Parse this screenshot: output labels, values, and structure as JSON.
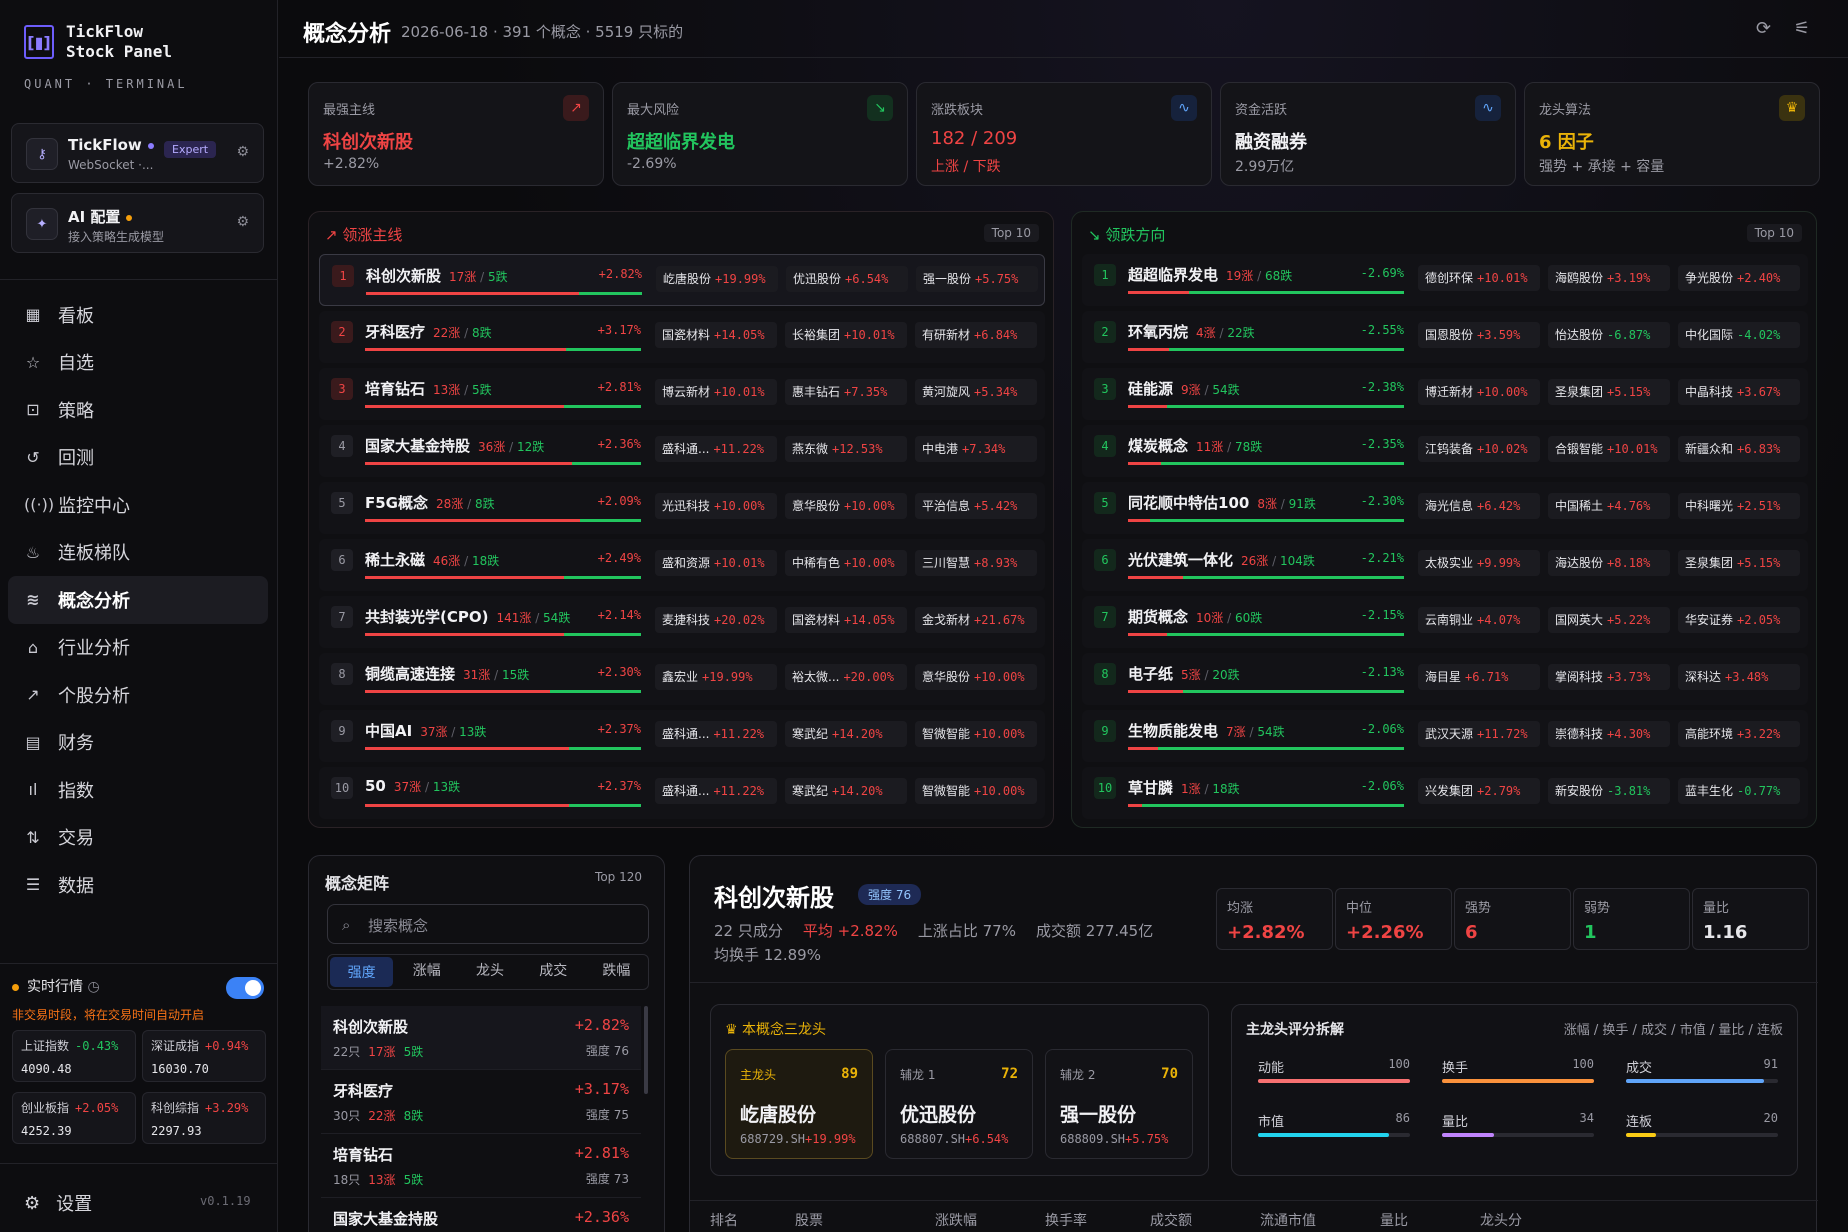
{
  "brand": {
    "title1": "TickFlow",
    "title2": "Stock Panel",
    "sub": "QUANT · TERMINAL",
    "mark": "[▮]"
  },
  "cards": {
    "tickflow": {
      "title": "TickFlow",
      "sub": "WebSocket ·...",
      "badge": "Expert"
    },
    "ai": {
      "title": "AI 配置",
      "sub": "接入策略生成模型"
    }
  },
  "nav": [
    "看板",
    "自选",
    "策略",
    "回测",
    "监控中心",
    "连板梯队",
    "概念分析",
    "行业分析",
    "个股分析",
    "财务",
    "指数",
    "交易",
    "数据"
  ],
  "nav_icons": [
    "grid-icon",
    "star-icon",
    "scan-icon",
    "history-icon",
    "radio-icon",
    "flame-icon",
    "layers-icon",
    "bank-icon",
    "trend-icon",
    "file-icon",
    "bar-chart-icon",
    "exchange-icon",
    "database-icon"
  ],
  "nav_glyphs": [
    "▦",
    "☆",
    "⊡",
    "↺",
    "((·))",
    "♨",
    "≋",
    "⌂",
    "↗",
    "▤",
    "ıl",
    "⇅",
    "☰"
  ],
  "realtime": {
    "label": "实时行情",
    "hint": "非交易时段，将在交易时间自动开启"
  },
  "indices": [
    {
      "name": "上证指数",
      "pct": "-0.43%",
      "val": "4090.48",
      "dir": "dn"
    },
    {
      "name": "深证成指",
      "pct": "+0.94%",
      "val": "16030.70",
      "dir": "up"
    },
    {
      "name": "创业板指",
      "pct": "+2.05%",
      "val": "4252.39",
      "dir": "up"
    },
    {
      "name": "科创综指",
      "pct": "+3.29%",
      "val": "2297.93",
      "dir": "up"
    }
  ],
  "settings": "设置",
  "version": "v0.1.19",
  "header": {
    "title": "概念分析",
    "meta": "2026-06-18 · 391 个概念 · 5519 只标的"
  },
  "kpis": [
    {
      "label": "最强主线",
      "value": "科创次新股",
      "sub": "+2.82%",
      "vcls": "up",
      "scls": "up",
      "icon": "↗",
      "icls": "#3a1a1c",
      "icol": "#ef4444"
    },
    {
      "label": "最大风险",
      "value": "超超临界发电",
      "sub": "-2.69%",
      "vcls": "dn",
      "scls": "dn",
      "icon": "↘",
      "icls": "#13301f",
      "icol": "#22c55e"
    },
    {
      "label": "涨跌板块",
      "value": "182 / 209",
      "sub": "上涨 / 下跌",
      "vcls": "up",
      "scls": "",
      "icon": "∿",
      "icls": "#16223c",
      "icol": "#60a5fa"
    },
    {
      "label": "资金活跃",
      "value": "融资融券",
      "sub": "2.99万亿",
      "vcls": "",
      "scls": "",
      "icon": "∿",
      "icls": "#16223c",
      "icol": "#60a5fa"
    },
    {
      "label": "龙头算法",
      "value": "6 因子",
      "sub": "强势 + 承接 + 容量",
      "vcls": "gold",
      "scls": "",
      "icon": "♛",
      "icls": "#3a3210",
      "icol": "#eab308"
    }
  ],
  "lead": {
    "title": "领涨主线",
    "top": "Top 10",
    "rows": [
      {
        "name": "科创次新股",
        "up": "17涨",
        "dn": "5跌",
        "pct": "+2.82%",
        "ratio": 77,
        "chips": [
          [
            "屹唐股份",
            "+19.99%"
          ],
          [
            "优迅股份",
            "+6.54%"
          ],
          [
            "强一股份",
            "+5.75%"
          ]
        ]
      },
      {
        "name": "牙科医疗",
        "up": "22涨",
        "dn": "8跌",
        "pct": "+3.17%",
        "ratio": 73,
        "chips": [
          [
            "国瓷材料",
            "+14.05%"
          ],
          [
            "长裕集团",
            "+10.01%"
          ],
          [
            "有研新材",
            "+6.84%"
          ]
        ]
      },
      {
        "name": "培育钻石",
        "up": "13涨",
        "dn": "5跌",
        "pct": "+2.81%",
        "ratio": 72,
        "chips": [
          [
            "博云新材",
            "+10.01%"
          ],
          [
            "惠丰钻石",
            "+7.35%"
          ],
          [
            "黄河旋风",
            "+5.34%"
          ]
        ]
      },
      {
        "name": "国家大基金持股",
        "up": "36涨",
        "dn": "12跌",
        "pct": "+2.36%",
        "ratio": 75,
        "chips": [
          [
            "盛科通...",
            "+11.22%"
          ],
          [
            "燕东微",
            "+12.53%"
          ],
          [
            "中电港",
            "+7.34%"
          ]
        ]
      },
      {
        "name": "F5G概念",
        "up": "28涨",
        "dn": "8跌",
        "pct": "+2.09%",
        "ratio": 78,
        "chips": [
          [
            "光迅科技",
            "+10.00%"
          ],
          [
            "意华股份",
            "+10.00%"
          ],
          [
            "平治信息",
            "+5.42%"
          ]
        ]
      },
      {
        "name": "稀土永磁",
        "up": "46涨",
        "dn": "18跌",
        "pct": "+2.49%",
        "ratio": 72,
        "chips": [
          [
            "盛和资源",
            "+10.01%"
          ],
          [
            "中稀有色",
            "+10.00%"
          ],
          [
            "三川智慧",
            "+8.93%"
          ]
        ]
      },
      {
        "name": "共封装光学(CPO)",
        "up": "141涨",
        "dn": "54跌",
        "pct": "+2.14%",
        "ratio": 72,
        "chips": [
          [
            "麦捷科技",
            "+20.02%"
          ],
          [
            "国瓷材料",
            "+14.05%"
          ],
          [
            "金戈新材",
            "+21.67%"
          ]
        ]
      },
      {
        "name": "铜缆高速连接",
        "up": "31涨",
        "dn": "15跌",
        "pct": "+2.30%",
        "ratio": 67,
        "chips": [
          [
            "鑫宏业",
            "+19.99%"
          ],
          [
            "裕太微...",
            "+20.00%"
          ],
          [
            "意华股份",
            "+10.00%"
          ]
        ]
      },
      {
        "name": "中国AI",
        "up": "37涨",
        "dn": "13跌",
        "pct": "+2.37%",
        "ratio": 74,
        "chips": [
          [
            "盛科通...",
            "+11.22%"
          ],
          [
            "寒武纪",
            "+14.20%"
          ],
          [
            "智微智能",
            "+10.00%"
          ]
        ]
      },
      {
        "name": "50",
        "up": "37涨",
        "dn": "13跌",
        "pct": "+2.37%",
        "ratio": 74,
        "chips": [
          [
            "盛科通...",
            "+11.22%"
          ],
          [
            "寒武纪",
            "+14.20%"
          ],
          [
            "智微智能",
            "+10.00%"
          ]
        ]
      }
    ]
  },
  "lag": {
    "title": "领跌方向",
    "top": "Top 10",
    "rows": [
      {
        "name": "超超临界发电",
        "up": "19涨",
        "dn": "68跌",
        "pct": "-2.69%",
        "ratio": 22,
        "chips": [
          [
            "德创环保",
            "+10.01%",
            "up"
          ],
          [
            "海鸥股份",
            "+3.19%",
            "up"
          ],
          [
            "争光股份",
            "+2.40%",
            "up"
          ]
        ]
      },
      {
        "name": "环氧丙烷",
        "up": "4涨",
        "dn": "22跌",
        "pct": "-2.55%",
        "ratio": 15,
        "chips": [
          [
            "国恩股份",
            "+3.59%",
            "up"
          ],
          [
            "怡达股份",
            "-6.87%",
            "dn"
          ],
          [
            "中化国际",
            "-4.02%",
            "dn"
          ]
        ]
      },
      {
        "name": "硅能源",
        "up": "9涨",
        "dn": "54跌",
        "pct": "-2.38%",
        "ratio": 14,
        "chips": [
          [
            "博迁新材",
            "+10.00%",
            "up"
          ],
          [
            "圣泉集团",
            "+5.15%",
            "up"
          ],
          [
            "中晶科技",
            "+3.67%",
            "up"
          ]
        ]
      },
      {
        "name": "煤炭概念",
        "up": "11涨",
        "dn": "78跌",
        "pct": "-2.35%",
        "ratio": 12,
        "chips": [
          [
            "江钨装备",
            "+10.02%",
            "up"
          ],
          [
            "合锻智能",
            "+10.01%",
            "up"
          ],
          [
            "新疆众和",
            "+6.83%",
            "up"
          ]
        ]
      },
      {
        "name": "同花顺中特估100",
        "up": "8涨",
        "dn": "91跌",
        "pct": "-2.30%",
        "ratio": 8,
        "chips": [
          [
            "海光信息",
            "+6.42%",
            "up"
          ],
          [
            "中国稀土",
            "+4.76%",
            "up"
          ],
          [
            "中科曙光",
            "+2.51%",
            "up"
          ]
        ]
      },
      {
        "name": "光伏建筑一体化",
        "up": "26涨",
        "dn": "104跌",
        "pct": "-2.21%",
        "ratio": 20,
        "chips": [
          [
            "太极实业",
            "+9.99%",
            "up"
          ],
          [
            "海达股份",
            "+8.18%",
            "up"
          ],
          [
            "圣泉集团",
            "+5.15%",
            "up"
          ]
        ]
      },
      {
        "name": "期货概念",
        "up": "10涨",
        "dn": "60跌",
        "pct": "-2.15%",
        "ratio": 14,
        "chips": [
          [
            "云南铜业",
            "+4.07%",
            "up"
          ],
          [
            "国网英大",
            "+5.22%",
            "up"
          ],
          [
            "华安证券",
            "+2.05%",
            "up"
          ]
        ]
      },
      {
        "name": "电子纸",
        "up": "5涨",
        "dn": "20跌",
        "pct": "-2.13%",
        "ratio": 20,
        "chips": [
          [
            "海目星",
            "+6.71%",
            "up"
          ],
          [
            "掌阅科技",
            "+3.73%",
            "up"
          ],
          [
            "深科达",
            "+3.48%",
            "up"
          ]
        ]
      },
      {
        "name": "生物质能发电",
        "up": "7涨",
        "dn": "54跌",
        "pct": "-2.06%",
        "ratio": 11,
        "chips": [
          [
            "武汉天源",
            "+11.72%",
            "up"
          ],
          [
            "崇德科技",
            "+4.30%",
            "up"
          ],
          [
            "高能环境",
            "+3.22%",
            "up"
          ]
        ]
      },
      {
        "name": "草甘膦",
        "up": "1涨",
        "dn": "18跌",
        "pct": "-2.06%",
        "ratio": 5,
        "chips": [
          [
            "兴发集团",
            "+2.79%",
            "up"
          ],
          [
            "新安股份",
            "-3.81%",
            "dn"
          ],
          [
            "蓝丰生化",
            "-0.77%",
            "dn"
          ]
        ]
      }
    ]
  },
  "matrix": {
    "title": "概念矩阵",
    "top": "Top 120",
    "search_ph": "搜索概念",
    "tabs": [
      "强度",
      "涨幅",
      "龙头",
      "成交",
      "跌幅"
    ],
    "rows": [
      {
        "name": "科创次新股",
        "pct": "+2.82%",
        "n": "22只",
        "up": "17涨",
        "dn": "5跌",
        "str": "强度 76"
      },
      {
        "name": "牙科医疗",
        "pct": "+3.17%",
        "n": "30只",
        "up": "22涨",
        "dn": "8跌",
        "str": "强度 75"
      },
      {
        "name": "培育钻石",
        "pct": "+2.81%",
        "n": "18只",
        "up": "13涨",
        "dn": "5跌",
        "str": "强度 73"
      },
      {
        "name": "国家大基金持股",
        "pct": "+2.36%",
        "n": "",
        "up": "",
        "dn": "",
        "str": ""
      }
    ]
  },
  "detail": {
    "title": "科创次新股",
    "badge": "强度 76",
    "count": "22 只成分",
    "avg": "平均 +2.82%",
    "upratio": "上涨占比 77%",
    "amount": "成交额 277.45亿",
    "turnover": "均换手 12.89%",
    "metrics": [
      {
        "l": "均涨",
        "v": "+2.82%",
        "c": "up"
      },
      {
        "l": "中位",
        "v": "+2.26%",
        "c": "up"
      },
      {
        "l": "强势",
        "v": "6",
        "c": "up"
      },
      {
        "l": "弱势",
        "v": "1",
        "c": "dn"
      },
      {
        "l": "量比",
        "v": "1.16",
        "c": ""
      }
    ],
    "dragon_title": "本概念三龙头",
    "dragons": [
      {
        "role": "主龙头",
        "score": "89",
        "name": "屹唐股份",
        "code": "688729.SH",
        "pct": "+19.99%"
      },
      {
        "role": "辅龙 1",
        "score": "72",
        "name": "优迅股份",
        "code": "688807.SH",
        "pct": "+6.54%"
      },
      {
        "role": "辅龙 2",
        "score": "70",
        "name": "强一股份",
        "code": "688809.SH",
        "pct": "+5.75%"
      }
    ],
    "score_title": "主龙头评分拆解",
    "score_legend": "涨幅 / 换手 / 成交 / 市值 / 量比 / 连板",
    "scores": [
      {
        "l": "动能",
        "v": "100",
        "c": "#f87171"
      },
      {
        "l": "换手",
        "v": "100",
        "c": "#fb923c"
      },
      {
        "l": "成交",
        "v": "91",
        "c": "#60a5fa"
      },
      {
        "l": "市值",
        "v": "86",
        "c": "#22d3ee"
      },
      {
        "l": "量比",
        "v": "34",
        "c": "#c084fc"
      },
      {
        "l": "连板",
        "v": "20",
        "c": "#facc15"
      }
    ],
    "table_headers": [
      "排名",
      "股票",
      "涨跌幅",
      "换手率",
      "成交额",
      "流通市值",
      "量比",
      "龙头分"
    ]
  }
}
